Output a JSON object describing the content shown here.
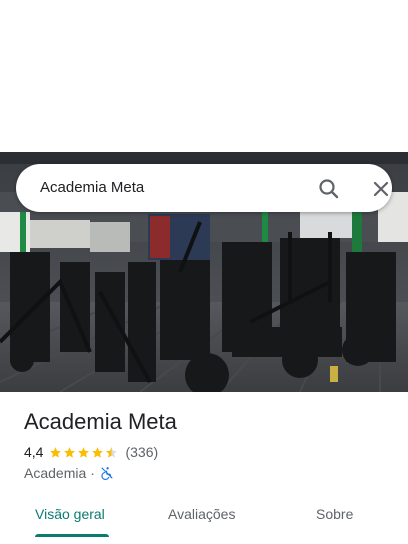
{
  "search": {
    "query": "Academia Meta",
    "search_icon": "search-icon",
    "close_icon": "close-icon"
  },
  "photo": {
    "subject": "gym-interior-photo"
  },
  "place": {
    "name": "Academia Meta",
    "rating": "4,4",
    "rating_number": 4.4,
    "stars_max": 5,
    "reviews": "(336)",
    "category": "Academia",
    "separator": "·",
    "accessibility_icon": "no-wheelchair-access-icon",
    "star_color": "#fbbc04",
    "accessibility_color": "#1a73e8"
  },
  "tabs": [
    {
      "label": "Visão geral",
      "active": true
    },
    {
      "label": "Avaliações",
      "active": false
    },
    {
      "label": "Sobre",
      "active": false
    }
  ],
  "colors": {
    "accent": "#0b7b72",
    "text": "#202124",
    "secondary_text": "#5f6368"
  }
}
